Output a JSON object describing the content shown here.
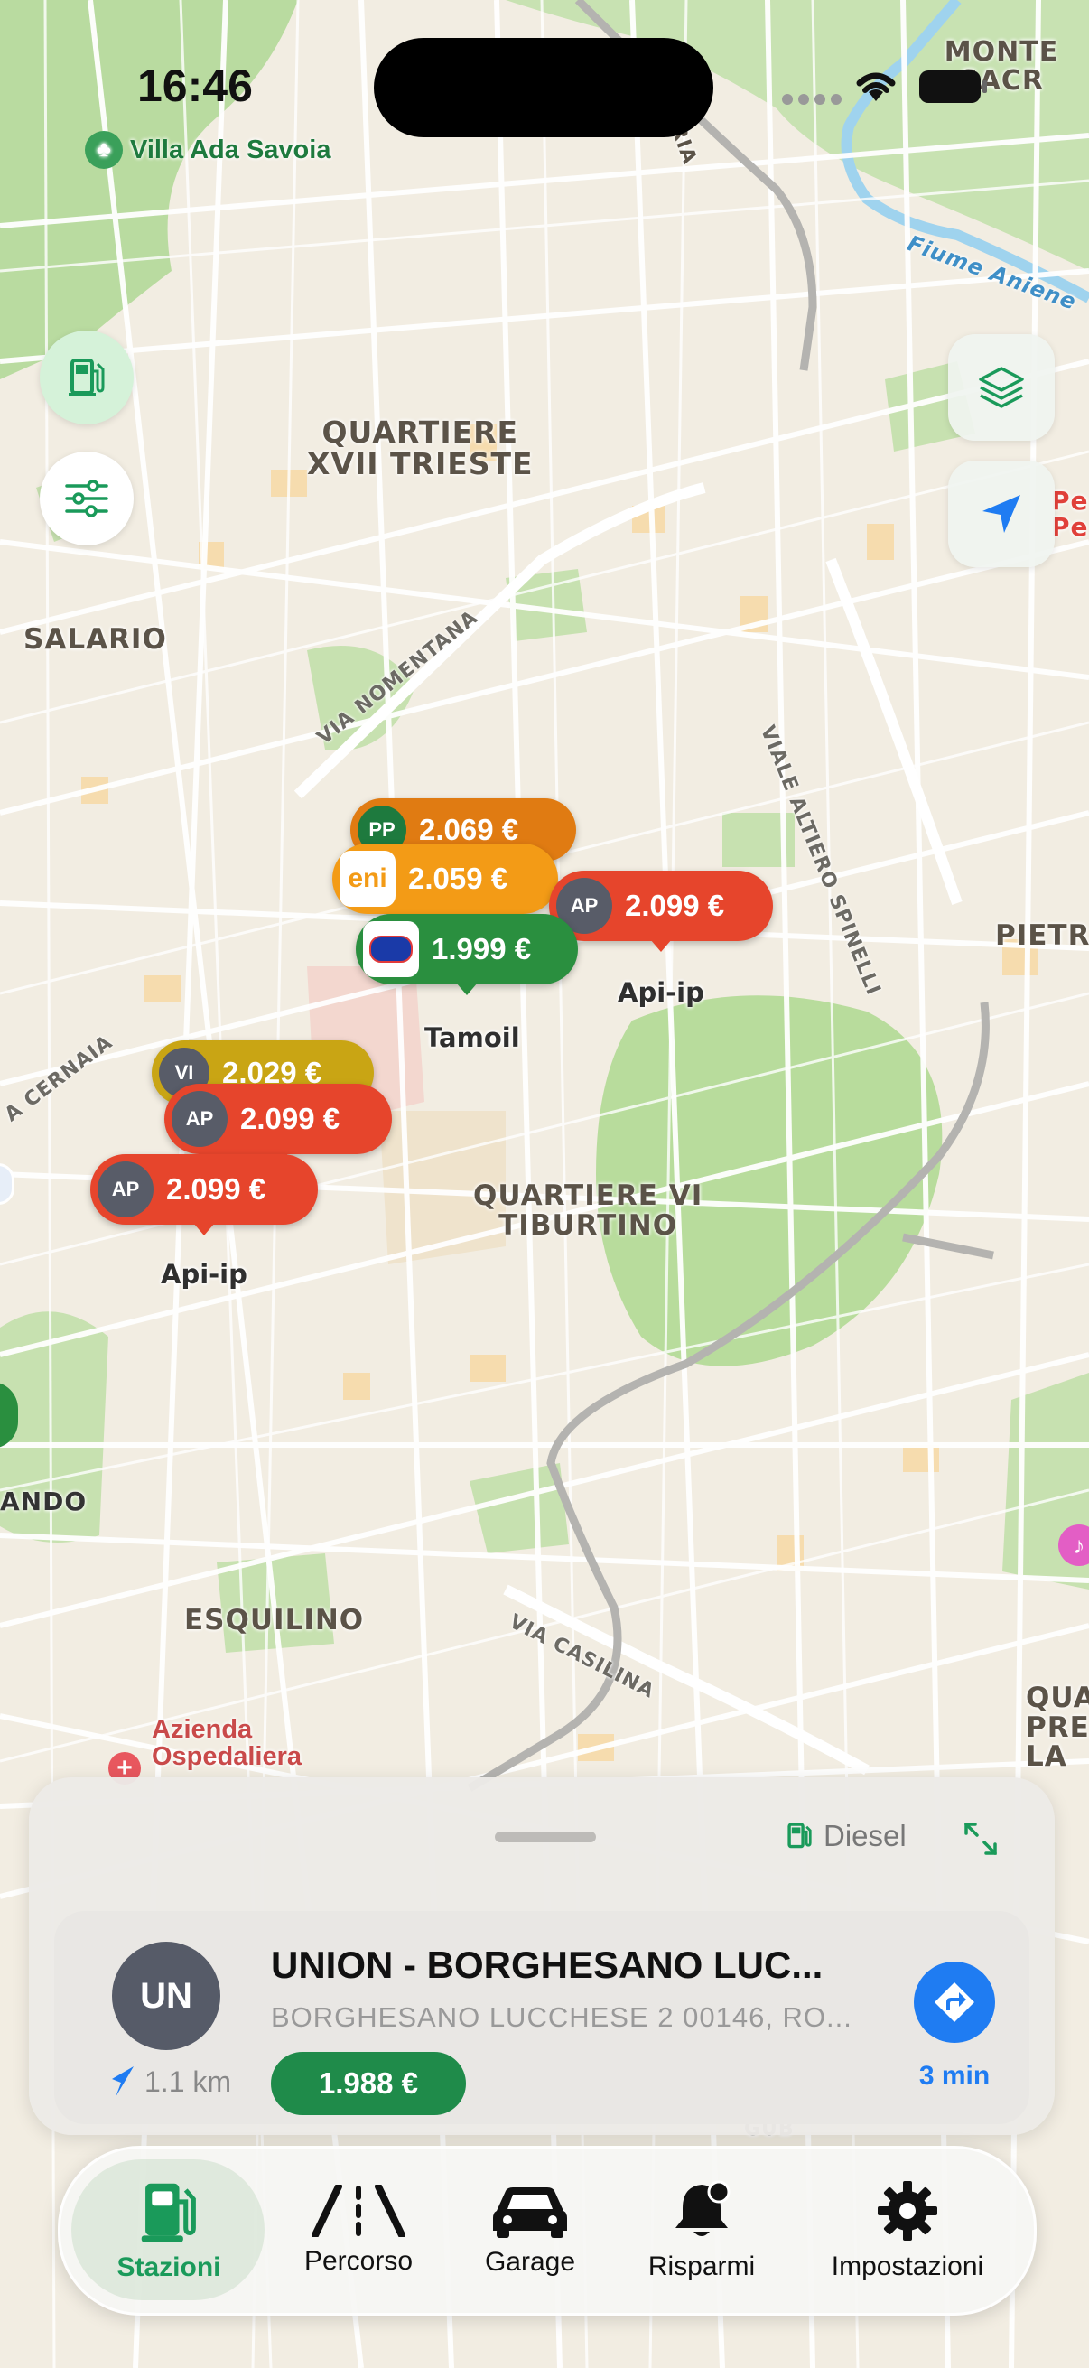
{
  "status": {
    "time": "16:46"
  },
  "map": {
    "labels": {
      "villa": "Villa Ada Savoia",
      "monte": "MONTE SACR",
      "trieste": "QUARTIERE\nXVII TRIESTE",
      "salario": "SALARIO",
      "pietra": "PIETRA",
      "tiburtino": "QUARTIERE VI\nTIBURTINO",
      "esquilino": "ESQUILINO",
      "azienda": "Azienda\nOspedaliera",
      "fiume": "Fiume Aniene",
      "qua": "QUA\nPRE\nLA",
      "pe": "Pe\nPe",
      "ando": "ANDO",
      "aria": "ARIA",
      "gub": "GUB"
    },
    "roads": {
      "nomentana": "VIA NOMENTANA",
      "altiero": "VIALE ALTIERO SPINELLI",
      "cernaia": "A CERNAIA",
      "casilina": "VIA CASILINA"
    },
    "pins": [
      {
        "brand": "PP",
        "price": "2.069 €",
        "color": "#e07b12"
      },
      {
        "brand": "eni",
        "price": "2.059 €",
        "color": "#f39b16"
      },
      {
        "brand": "AP",
        "price": "2.099 €",
        "color": "#e6452c",
        "label": "Api-ip"
      },
      {
        "brand": "TAMOIL",
        "price": "1.999 €",
        "color": "#2a8f3f",
        "label": "Tamoil"
      },
      {
        "brand": "VI",
        "price": "2.029 €",
        "color": "#c9a514"
      },
      {
        "brand": "AP",
        "price": "2.099 €",
        "color": "#e6452c"
      },
      {
        "brand": "AP",
        "price": "2.099 €",
        "color": "#e6452c",
        "label": "Api-ip"
      }
    ]
  },
  "controls": {
    "fuel_icon": "fuel-pump-icon",
    "filter_icon": "sliders-icon",
    "layers_icon": "layers-icon",
    "location_icon": "location-arrow-icon"
  },
  "sheet": {
    "fuel_type": "Diesel",
    "station": {
      "initials": "UN",
      "name": "UNION - BORGHESANO LUC...",
      "address": "BORGHESANO LUCCHESE 2 00146, RO...",
      "distance": "1.1 km",
      "price": "1.988 €",
      "eta": "3 min"
    }
  },
  "tabs": [
    {
      "label": "Stazioni",
      "icon": "fuel-pump-icon",
      "active": true
    },
    {
      "label": "Percorso",
      "icon": "road-icon",
      "active": false
    },
    {
      "label": "Garage",
      "icon": "car-icon",
      "active": false
    },
    {
      "label": "Risparmi",
      "icon": "bell-icon",
      "active": false
    },
    {
      "label": "Impostazioni",
      "icon": "gear-icon",
      "active": false
    }
  ],
  "colors": {
    "accent": "#1a9a5a",
    "blue": "#1f7cf2",
    "price_green": "#1f8b4a"
  }
}
